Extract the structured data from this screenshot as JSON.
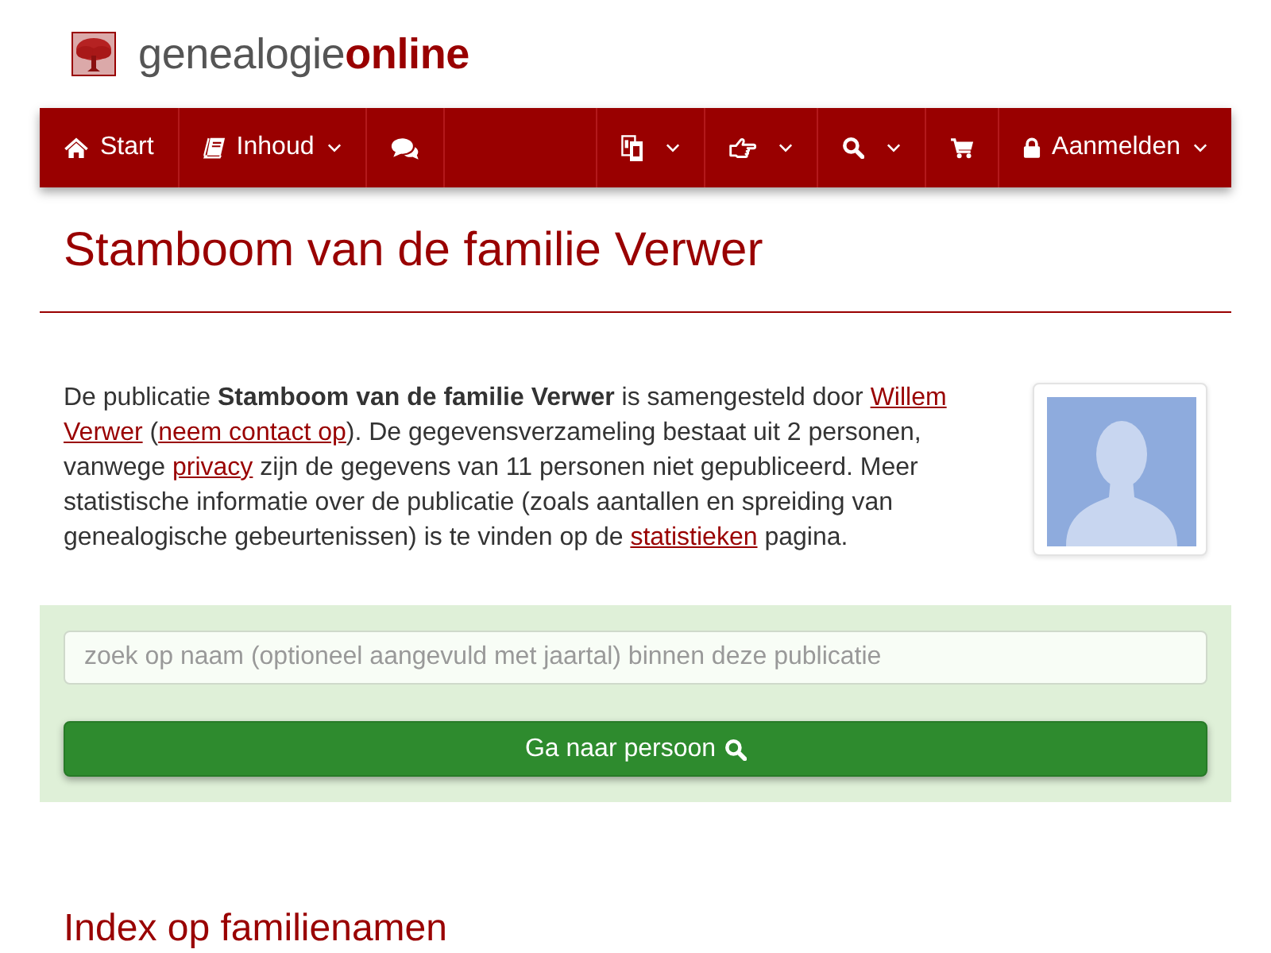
{
  "logo": {
    "text": "genealogie**online**"
  },
  "nav": {
    "left": [
      {
        "label": "Start",
        "dropdown": false
      },
      {
        "label": "Inhoud",
        "dropdown": true
      },
      {
        "dropdown": false
      }
    ],
    "right": [
      {
        "dropdown": true
      },
      {
        "dropdown": true
      },
      {
        "dropdown": true
      },
      {
        "dropdown": false
      },
      {
        "label": "Aanmelden",
        "dropdown": true
      }
    ]
  },
  "title": "Stamboom van de familie Verwer",
  "intro": [
    {
      "kind": "text",
      "text": "De publicatie **Stamboom van de familie Verwer** is samengesteld door "
    },
    {
      "kind": "link",
      "parts": [
        "Willem",
        "Verwer"
      ]
    },
    {
      "kind": "text",
      "text": " ("
    },
    {
      "kind": "link",
      "parts": [
        "neem contact op"
      ]
    },
    {
      "kind": "text",
      "text": "). De gegevensverzameling bestaat uit 2 personen, vanwege "
    },
    {
      "kind": "link",
      "parts": [
        "privacy"
      ]
    },
    {
      "kind": "text",
      "text": " zijn de gegevens van 11 personen niet gepubliceerd. Meer statistische informatie over de publicatie (zoals aantallen en spreiding van genealogische gebeurtenissen) is te vinden op de "
    },
    {
      "kind": "link",
      "parts": [
        "statistieken"
      ]
    },
    {
      "kind": "text",
      "text": " pagina."
    }
  ],
  "search": {
    "placeholder": "zoek op naam (optioneel aangevuld met jaartal) binnen deze publicatie",
    "button": "Ga naar persoon"
  },
  "section_heading": "Index op familienamen"
}
